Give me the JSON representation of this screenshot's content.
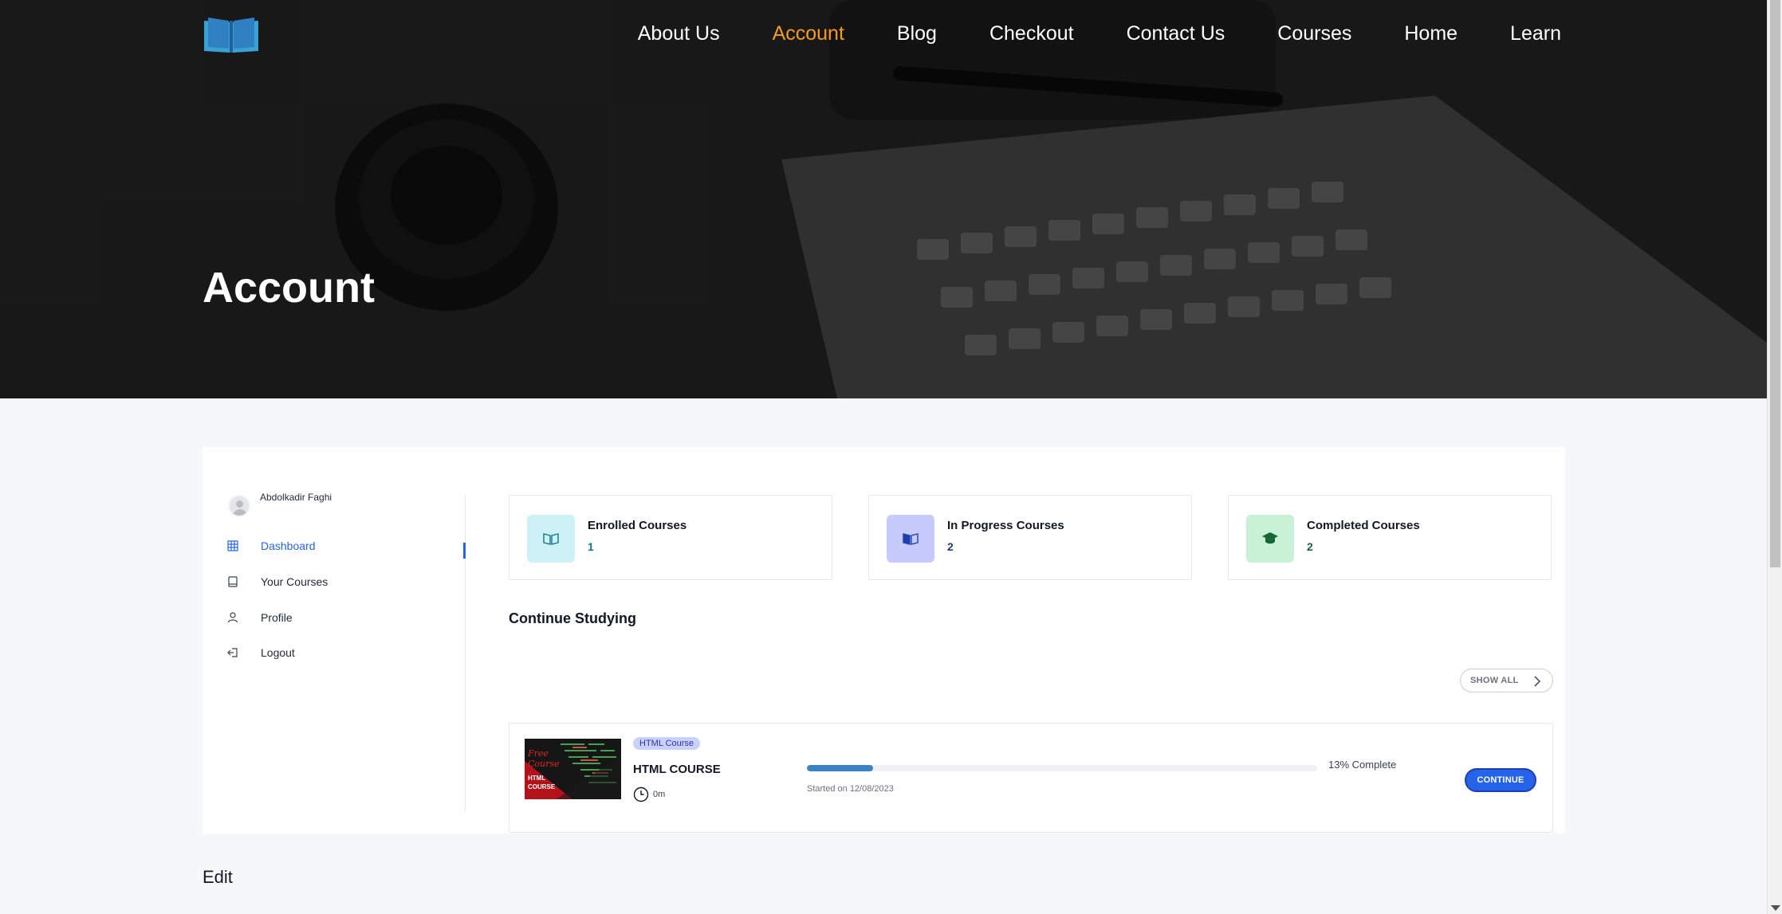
{
  "header": {
    "logo": "book-logo",
    "nav": [
      "About Us",
      "Account",
      "Blog",
      "Checkout",
      "Contact Us",
      "Courses",
      "Home",
      "Learn"
    ],
    "active_nav": "Account"
  },
  "hero": {
    "title": "Account"
  },
  "sidebar": {
    "user_name": "Abdolkadir Faghi",
    "items": [
      {
        "label": "Dashboard",
        "icon": "grid-icon",
        "active": true
      },
      {
        "label": "Your Courses",
        "icon": "book-icon",
        "active": false
      },
      {
        "label": "Profile",
        "icon": "user-icon",
        "active": false
      },
      {
        "label": "Logout",
        "icon": "logout-icon",
        "active": false
      }
    ]
  },
  "stats": [
    {
      "title": "Enrolled Courses",
      "value": "1",
      "icon": "open-book-icon",
      "bg": "#cdf1f6",
      "color": "#0e7490"
    },
    {
      "title": "In Progress Courses",
      "value": "2",
      "icon": "book-half-icon",
      "bg": "#c7cbfb",
      "color": "#1e3a8a"
    },
    {
      "title": "Completed Courses",
      "value": "2",
      "icon": "graduation-cap-icon",
      "bg": "#c9f1d6",
      "color": "#166534"
    }
  ],
  "continue": {
    "title": "Continue Studying",
    "show_all": "SHOW ALL",
    "course": {
      "badge": "HTML Course",
      "title": "HTML COURSE",
      "duration": "0m",
      "progress": 13,
      "progress_label": "13% Complete",
      "started": "Started on 12/08/2023",
      "button": "CONTINUE",
      "thumb_text_1": "Free",
      "thumb_text_2": "Course",
      "thumb_text_3": "HTML",
      "thumb_text_4": "COURSE"
    }
  },
  "footer": {
    "edit_label": "Edit"
  },
  "colors": {
    "accent": "#2563eb",
    "nav_active": "#f29b24"
  }
}
